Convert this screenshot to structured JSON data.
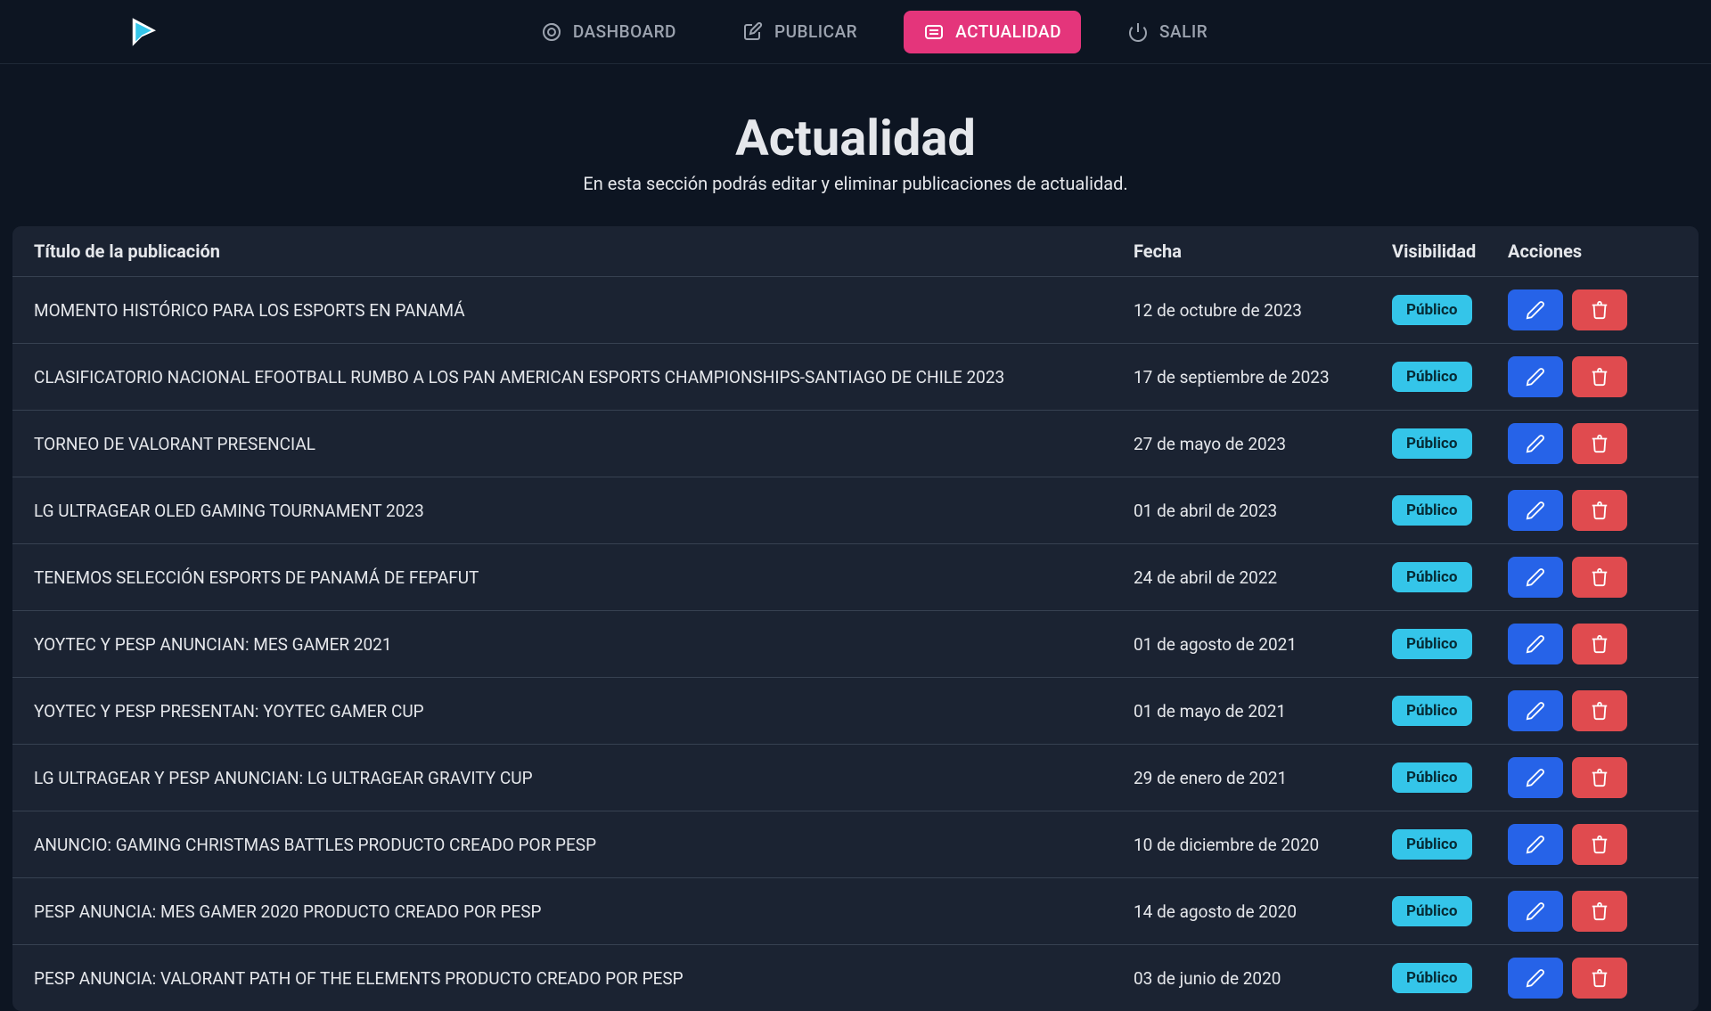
{
  "nav": {
    "items": [
      {
        "label": "DASHBOARD",
        "active": false
      },
      {
        "label": "PUBLICAR",
        "active": false
      },
      {
        "label": "ACTUALIDAD",
        "active": true
      },
      {
        "label": "SALIR",
        "active": false
      }
    ]
  },
  "page": {
    "title": "Actualidad",
    "subtitle": "En esta sección podrás editar y eliminar publicaciones de actualidad."
  },
  "table": {
    "headers": {
      "title": "Título de la publicación",
      "date": "Fecha",
      "visibility": "Visibilidad",
      "actions": "Acciones"
    },
    "visibility_label": "Público",
    "rows": [
      {
        "title": "MOMENTO HISTÓRICO PARA LOS ESPORTS EN PANAMÁ",
        "date": "12 de octubre de 2023"
      },
      {
        "title": "CLASIFICATORIO NACIONAL EFOOTBALL RUMBO A LOS PAN AMERICAN ESPORTS CHAMPIONSHIPS-SANTIAGO DE CHILE 2023",
        "date": "17 de septiembre de 2023"
      },
      {
        "title": "TORNEO DE VALORANT PRESENCIAL",
        "date": "27 de mayo de 2023"
      },
      {
        "title": "LG ULTRAGEAR OLED GAMING TOURNAMENT 2023",
        "date": "01 de abril de 2023"
      },
      {
        "title": "TENEMOS SELECCIÓN ESPORTS DE PANAMÁ DE FEPAFUT",
        "date": "24 de abril de 2022"
      },
      {
        "title": "YOYTEC Y PESP ANUNCIAN: MES GAMER 2021",
        "date": "01 de agosto de 2021"
      },
      {
        "title": "YOYTEC Y PESP PRESENTAN: YOYTEC GAMER CUP",
        "date": "01 de mayo de 2021"
      },
      {
        "title": "LG ULTRAGEAR Y PESP ANUNCIAN: LG ULTRAGEAR GRAVITY CUP",
        "date": "29 de enero de 2021"
      },
      {
        "title": "ANUNCIO: GAMING CHRISTMAS BATTLES PRODUCTO CREADO POR PESP",
        "date": "10 de diciembre de 2020"
      },
      {
        "title": "PESP ANUNCIA: MES GAMER 2020 PRODUCTO CREADO POR PESP",
        "date": "14 de agosto de 2020"
      },
      {
        "title": "PESP ANUNCIA: VALORANT PATH OF THE ELEMENTS PRODUCTO CREADO POR PESP",
        "date": "03 de junio de 2020"
      }
    ]
  }
}
